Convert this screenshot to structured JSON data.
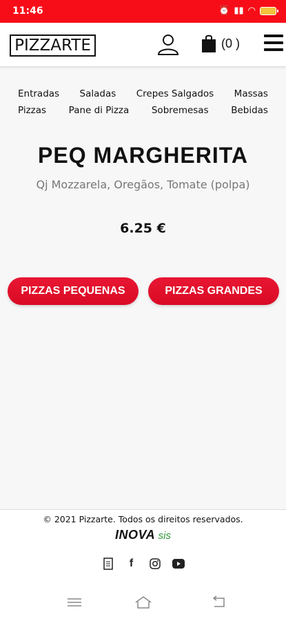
{
  "status": {
    "time": "11:46",
    "battery_color": "#f4c23c"
  },
  "header": {
    "logo": "PIZZARTE",
    "cart_count": "(0 )"
  },
  "categories": {
    "row1": [
      "Entradas",
      "Saladas",
      "Crepes Salgados",
      "Massas"
    ],
    "row2": [
      "Pizzas",
      "Pane di Pizza",
      "Sobremesas",
      "Bebidas"
    ]
  },
  "product": {
    "title": "PEQ MARGHERITA",
    "description": "Qj Mozzarela, Oregãos, Tomate (polpa)",
    "price": "6.25 €"
  },
  "buttons": {
    "small": "PIZZAS PEQUENAS",
    "big": "PIZZAS GRANDES",
    "color": "#e0102c"
  },
  "footer": {
    "copyright": "© 2021 Pizzarte. Todos os direitos reservados.",
    "brand": "INOVA",
    "brand_sub": "sis"
  },
  "icons": [
    "user-icon",
    "shopping-bag-icon",
    "menu-icon",
    "document-icon",
    "facebook-icon",
    "instagram-icon",
    "youtube-icon"
  ]
}
